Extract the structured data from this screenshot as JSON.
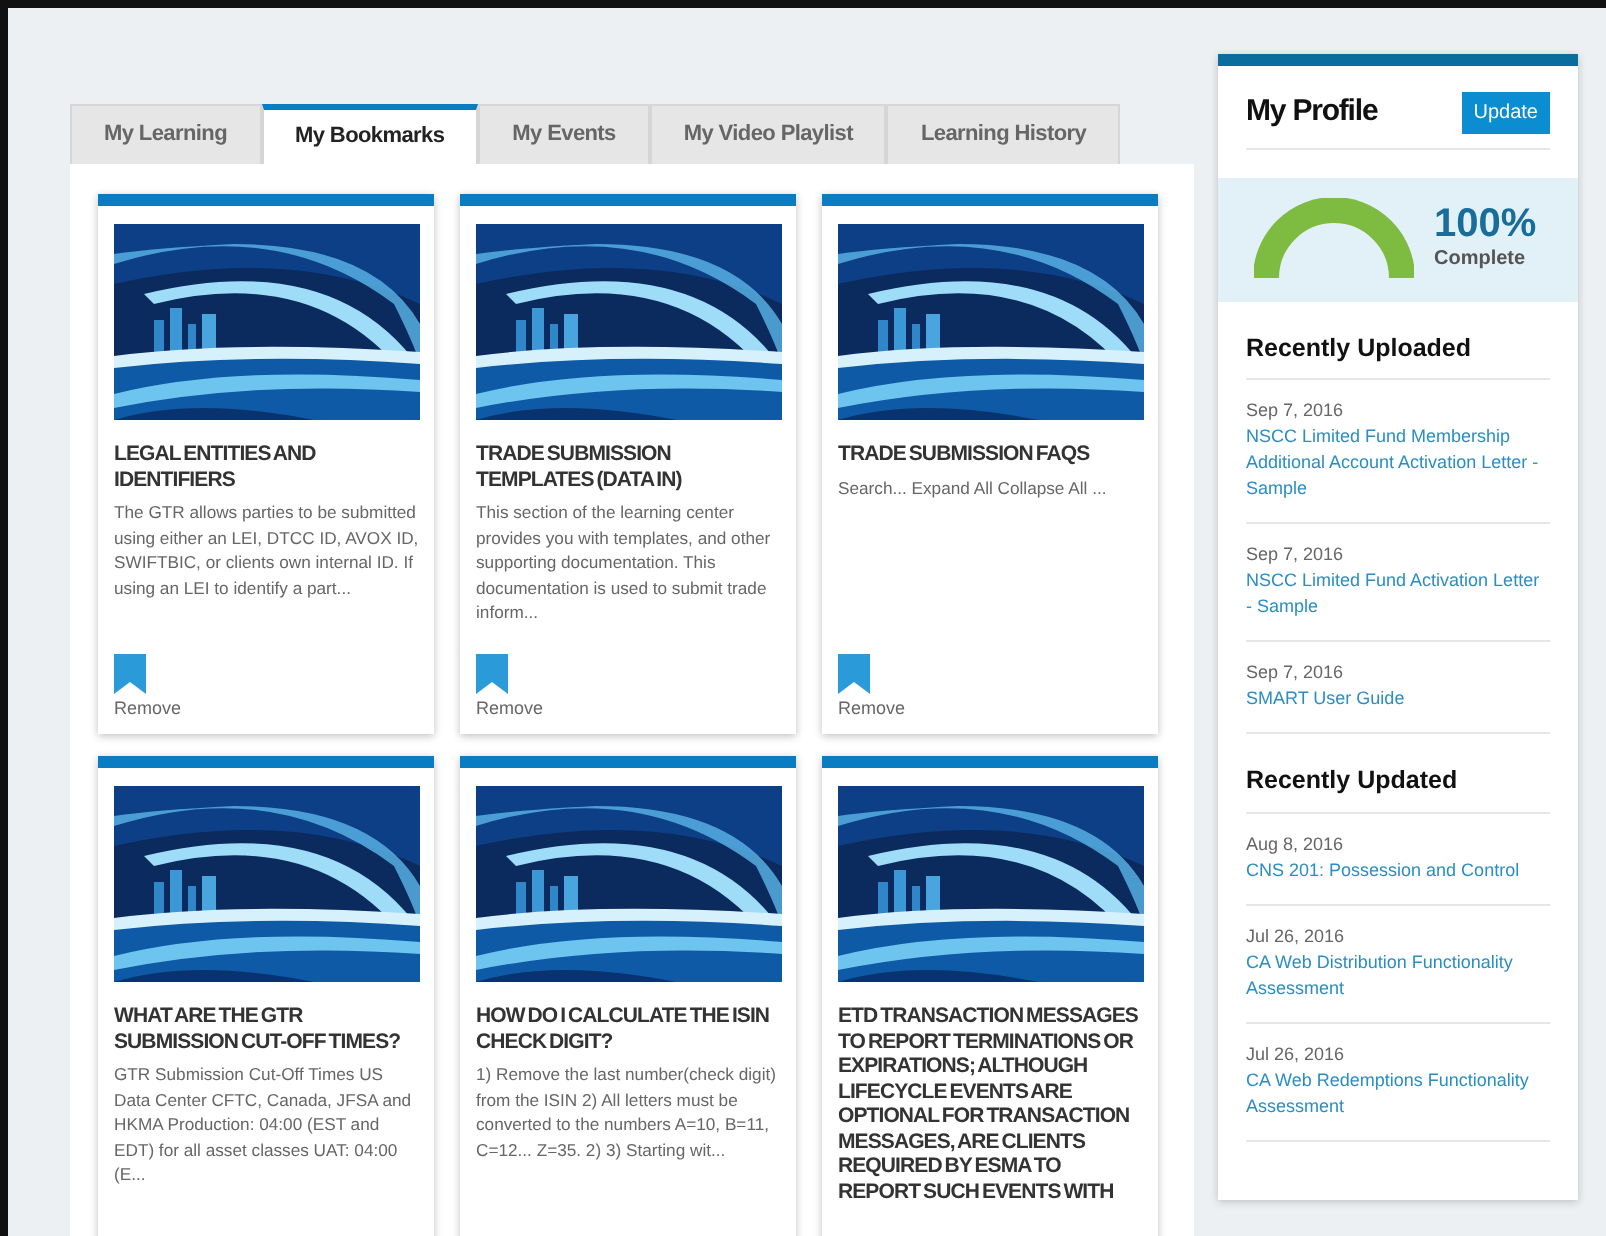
{
  "tabs": [
    {
      "label": "My Learning",
      "selected": false
    },
    {
      "label": "My Bookmarks",
      "selected": true
    },
    {
      "label": "My Events",
      "selected": false
    },
    {
      "label": "My Video Playlist",
      "selected": false
    },
    {
      "label": "Learning History",
      "selected": false
    }
  ],
  "bookmarks": [
    {
      "kind": "picture",
      "title": "LEGAL ENTITIES AND IDENTIFIERS",
      "summary": "The GTR allows parties to be submitted using either an LEI, DTCC ID, AVOX ID, SWIFTBIC, or clients own internal ID. If using an LEI to identify a part...",
      "action": "Remove"
    },
    {
      "kind": "picture",
      "title": "TRADE SUBMISSION TEMPLATES (DATA IN)",
      "summary": "This section of the learning center provides you with templates, and other supporting documentation. This documentation is used to submit trade inform...",
      "action": "Remove"
    },
    {
      "kind": "picture",
      "title": "TRADE SUBMISSION FAQS",
      "summary": "Search... Expand All Collapse All ...",
      "action": "Remove"
    },
    {
      "kind": "picture",
      "title": "WHAT ARE THE GTR SUBMISSION CUT-OFF TIMES?",
      "summary": "GTR Submission Cut-Off Times   US Data Center CFTC, Canada, JFSA and HKMA Production: 04:00 (EST and EDT) for all asset classes UAT: 04:00 (E..."
    },
    {
      "kind": "picture",
      "title": "HOW DO I CALCULATE THE ISIN CHECK DIGIT?",
      "summary": "1) Remove the last number(check digit) from the ISIN 2) All letters must be converted to the numbers A=10, B=11, C=12... Z=35. 2) 3) Starting wit..."
    },
    {
      "kind": "picture",
      "title": "ETD TRANSACTION MESSAGES TO REPORT TERMINATIONS OR EXPIRATIONS; ALTHOUGH LIFECYCLE EVENTS ARE OPTIONAL FOR TRANSACTION MESSAGES, ARE CLIENTS REQUIRED BY ESMA TO REPORT SUCH EVENTS WITH"
    }
  ],
  "profile": {
    "title": "My Profile",
    "button": "Update",
    "completion": {
      "level": 1,
      "percent": "100%",
      "label": "Complete"
    }
  },
  "sections": [
    {
      "heading": "Recently Uploaded",
      "items": [
        {
          "date": "Sep 7, 2016",
          "link": "NSCC Limited Fund Membership Additional Account Activation Letter - Sample"
        },
        {
          "date": "Sep 7, 2016",
          "link": "NSCC Limited Fund Activation Letter - Sample"
        },
        {
          "date": "Sep 7, 2016",
          "link": "SMART User Guide"
        }
      ]
    },
    {
      "heading": "Recently Updated",
      "items": [
        {
          "date": "Aug 8, 2016",
          "link": "CNS 201: Possession and Control"
        },
        {
          "date": "Jul 26, 2016",
          "link": "CA Web Distribution Functionality Assessment"
        },
        {
          "date": "Jul 26, 2016",
          "link": "CA Web Redemptions Functionality Assessment"
        }
      ]
    }
  ]
}
